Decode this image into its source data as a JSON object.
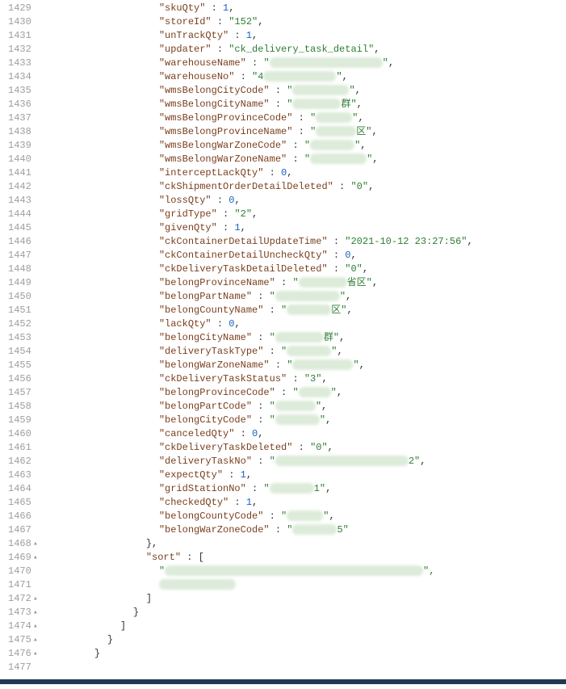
{
  "startLine": 1429,
  "foldLines": [
    1468,
    1469,
    1472,
    1473,
    1474,
    1475,
    1476
  ],
  "indentUnitPx": 8,
  "lines": [
    {
      "indent": 17,
      "key": "skuQty",
      "type": "num",
      "val": "1",
      "comma": true
    },
    {
      "indent": 17,
      "key": "storeId",
      "type": "str",
      "val": "152",
      "comma": true
    },
    {
      "indent": 17,
      "key": "unTrackQty",
      "type": "num",
      "val": "1",
      "comma": true
    },
    {
      "indent": 17,
      "key": "updater",
      "type": "str",
      "val": "ck_delivery_task_detail",
      "comma": true
    },
    {
      "indent": 17,
      "key": "warehouseName",
      "type": "redacted",
      "redactW": 140,
      "lead": "",
      "comma": true
    },
    {
      "indent": 17,
      "key": "warehouseNo",
      "type": "redacted",
      "redactW": 90,
      "lead": "4",
      "comma": true
    },
    {
      "indent": 17,
      "key": "wmsBelongCityCode",
      "type": "redacted",
      "redactW": 70,
      "lead": "",
      "comma": true
    },
    {
      "indent": 17,
      "key": "wmsBelongCityName",
      "type": "redacted",
      "redactW": 60,
      "lead": "",
      "tail": "群\"",
      "comma": true
    },
    {
      "indent": 17,
      "key": "wmsBelongProvinceCode",
      "type": "redacted",
      "redactW": 45,
      "lead": "",
      "comma": true
    },
    {
      "indent": 17,
      "key": "wmsBelongProvinceName",
      "type": "redacted",
      "redactW": 50,
      "lead": "",
      "tail": "区\"",
      "comma": true
    },
    {
      "indent": 17,
      "key": "wmsBelongWarZoneCode",
      "type": "redacted",
      "redactW": 55,
      "lead": "",
      "comma": true
    },
    {
      "indent": 17,
      "key": "wmsBelongWarZoneName",
      "type": "redacted",
      "redactW": 70,
      "lead": "",
      "comma": true
    },
    {
      "indent": 17,
      "key": "interceptLackQty",
      "type": "num",
      "val": "0",
      "comma": true
    },
    {
      "indent": 17,
      "key": "ckShipmentOrderDetailDeleted",
      "type": "str",
      "val": "0",
      "comma": true
    },
    {
      "indent": 17,
      "key": "lossQty",
      "type": "num",
      "val": "0",
      "comma": true
    },
    {
      "indent": 17,
      "key": "gridType",
      "type": "str",
      "val": "2",
      "comma": true
    },
    {
      "indent": 17,
      "key": "givenQty",
      "type": "num",
      "val": "1",
      "comma": true
    },
    {
      "indent": 17,
      "key": "ckContainerDetailUpdateTime",
      "type": "str",
      "val": "2021-10-12 23:27:56",
      "comma": true
    },
    {
      "indent": 17,
      "key": "ckContainerDetailUncheckQty",
      "type": "num",
      "val": "0",
      "comma": true
    },
    {
      "indent": 17,
      "key": "ckDeliveryTaskDetailDeleted",
      "type": "str",
      "val": "0",
      "comma": true
    },
    {
      "indent": 17,
      "key": "belongProvinceName",
      "type": "redacted",
      "redactW": 60,
      "lead": "",
      "tail": "省区\"",
      "comma": true
    },
    {
      "indent": 17,
      "key": "belongPartName",
      "type": "redacted",
      "redactW": 80,
      "lead": "",
      "comma": true
    },
    {
      "indent": 17,
      "key": "belongCountyName",
      "type": "redacted",
      "redactW": 55,
      "lead": "",
      "tail": "区\"",
      "comma": true
    },
    {
      "indent": 17,
      "key": "lackQty",
      "type": "num",
      "val": "0",
      "comma": true
    },
    {
      "indent": 17,
      "key": "belongCityName",
      "type": "redacted",
      "redactW": 60,
      "lead": "",
      "tail": "群\"",
      "comma": true
    },
    {
      "indent": 17,
      "key": "deliveryTaskType",
      "type": "redacted",
      "redactW": 55,
      "lead": "",
      "comma": true
    },
    {
      "indent": 17,
      "key": "belongWarZoneName",
      "type": "redacted",
      "redactW": 75,
      "lead": "",
      "comma": true
    },
    {
      "indent": 17,
      "key": "ckDeliveryTaskStatus",
      "type": "str",
      "val": "3",
      "comma": true
    },
    {
      "indent": 17,
      "key": "belongProvinceCode",
      "type": "redacted",
      "redactW": 40,
      "lead": "",
      "comma": true
    },
    {
      "indent": 17,
      "key": "belongPartCode",
      "type": "redacted",
      "redactW": 50,
      "lead": "",
      "comma": true
    },
    {
      "indent": 17,
      "key": "belongCityCode",
      "type": "redacted",
      "redactW": 55,
      "lead": "",
      "comma": true
    },
    {
      "indent": 17,
      "key": "canceledQty",
      "type": "num",
      "val": "0",
      "comma": true
    },
    {
      "indent": 17,
      "key": "ckDeliveryTaskDeleted",
      "type": "str",
      "val": "0",
      "comma": true
    },
    {
      "indent": 17,
      "key": "deliveryTaskNo",
      "type": "redacted",
      "redactW": 165,
      "lead": "",
      "tail": "2\"",
      "comma": true
    },
    {
      "indent": 17,
      "key": "expectQty",
      "type": "num",
      "val": "1",
      "comma": true
    },
    {
      "indent": 17,
      "key": "gridStationNo",
      "type": "redacted",
      "redactW": 55,
      "lead": "",
      "tail": "1\"",
      "comma": true
    },
    {
      "indent": 17,
      "key": "checkedQty",
      "type": "num",
      "val": "1",
      "comma": true
    },
    {
      "indent": 17,
      "key": "belongCountyCode",
      "type": "redacted",
      "redactW": 45,
      "lead": "",
      "comma": true
    },
    {
      "indent": 17,
      "key": "belongWarZoneCode",
      "type": "redacted",
      "redactW": 55,
      "lead": "",
      "tail": "5\"",
      "comma": false
    },
    {
      "indent": 15,
      "raw": "},",
      "type": "raw"
    },
    {
      "indent": 15,
      "key": "sort",
      "type": "arrOpen"
    },
    {
      "indent": 17,
      "type": "redactedLine",
      "redactW": 320,
      "lead": "\"",
      "tail": "\","
    },
    {
      "indent": 17,
      "type": "redactedLine",
      "redactW": 95,
      "lead": "",
      "tail": ""
    },
    {
      "indent": 15,
      "raw": "]",
      "type": "raw"
    },
    {
      "indent": 13,
      "raw": "}",
      "type": "raw"
    },
    {
      "indent": 11,
      "raw": "]",
      "type": "raw"
    },
    {
      "indent": 9,
      "raw": "}",
      "type": "raw"
    },
    {
      "indent": 7,
      "raw": "}",
      "type": "raw"
    },
    {
      "indent": 7,
      "raw": "",
      "type": "raw"
    }
  ]
}
